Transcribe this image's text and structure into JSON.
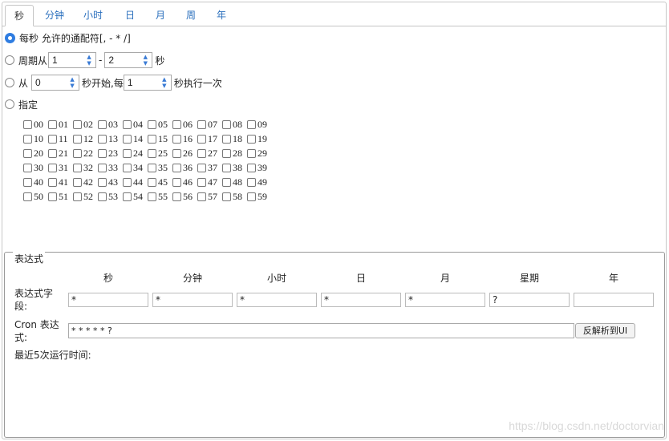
{
  "tabs": [
    "秒",
    "分钟",
    "小时",
    "日",
    "月",
    "周",
    "年"
  ],
  "options": {
    "every": "每秒 允许的通配符[, - * /]",
    "cycle_prefix": "周期从",
    "cycle_from": "1",
    "cycle_dash": "-",
    "cycle_to": "2",
    "cycle_suffix": "秒",
    "from_prefix": "从",
    "from_start": "0",
    "from_mid": "秒开始,每",
    "from_step": "1",
    "from_suffix": "秒执行一次",
    "specify": "指定"
  },
  "seconds": [
    "00",
    "01",
    "02",
    "03",
    "04",
    "05",
    "06",
    "07",
    "08",
    "09",
    "10",
    "11",
    "12",
    "13",
    "14",
    "15",
    "16",
    "17",
    "18",
    "19",
    "20",
    "21",
    "22",
    "23",
    "24",
    "25",
    "26",
    "27",
    "28",
    "29",
    "30",
    "31",
    "32",
    "33",
    "34",
    "35",
    "36",
    "37",
    "38",
    "39",
    "40",
    "41",
    "42",
    "43",
    "44",
    "45",
    "46",
    "47",
    "48",
    "49",
    "50",
    "51",
    "52",
    "53",
    "54",
    "55",
    "56",
    "57",
    "58",
    "59"
  ],
  "expression": {
    "legend": "表达式",
    "columns": [
      "秒",
      "分钟",
      "小时",
      "日",
      "月",
      "星期",
      "年"
    ],
    "field_label_1": "表达式字",
    "field_label_2": "段:",
    "field_values": [
      "*",
      "*",
      "*",
      "*",
      "*",
      "?",
      ""
    ],
    "cron_label_1": "Cron 表达",
    "cron_label_2": "式:",
    "cron_value": "* * * * * ?",
    "parse_button": "反解析到UI",
    "recent_label": "最近5次运行时间:"
  },
  "watermark": "https://blog.csdn.net/doctorvian"
}
